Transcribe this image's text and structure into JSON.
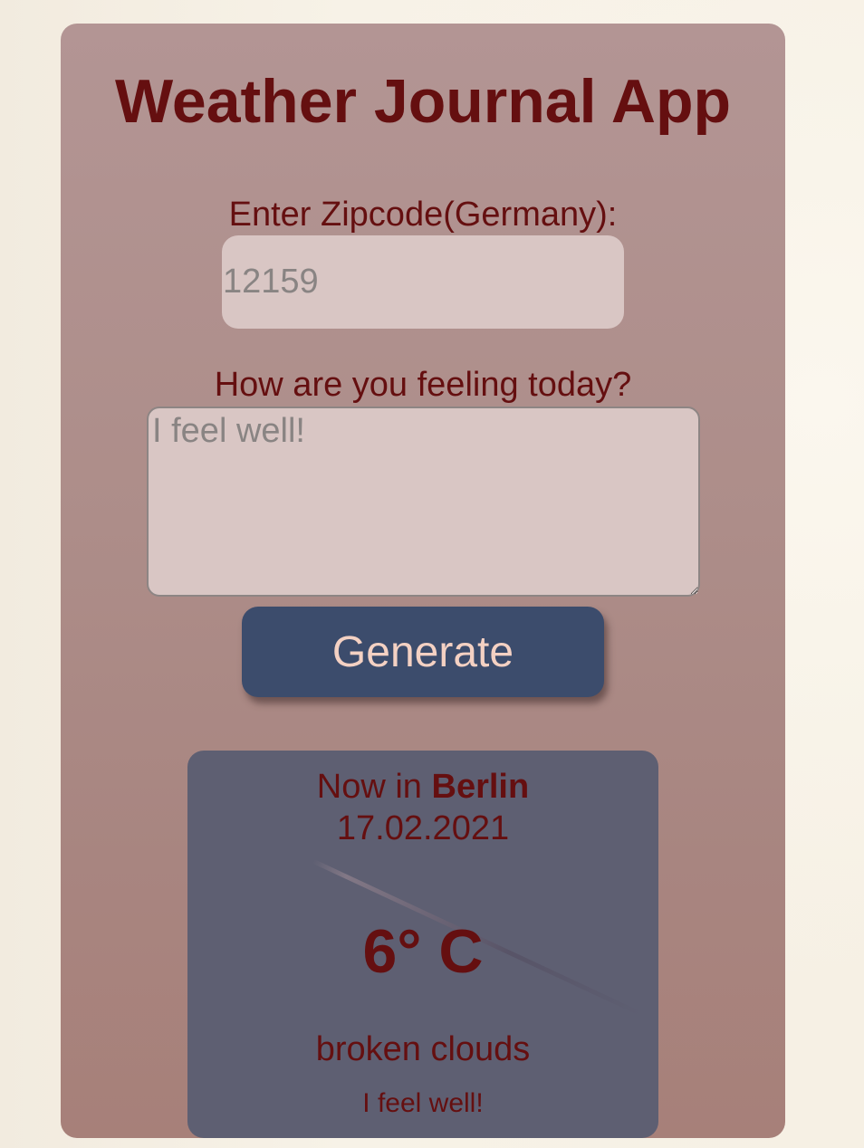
{
  "app": {
    "title": "Weather Journal App"
  },
  "form": {
    "zip_label": "Enter Zipcode(Germany):",
    "zip_placeholder": "12159",
    "feelings_label": "How are you feeling today?",
    "feelings_placeholder": "I feel well!",
    "generate_label": "Generate"
  },
  "entry": {
    "now_prefix": "Now in ",
    "city": "Berlin",
    "date": "17.02.2021",
    "temperature": "6° C",
    "description": "broken clouds",
    "content": "I feel well!"
  },
  "colors": {
    "title_text": "#650f10",
    "card_background": "#b39594",
    "input_background": "#d9c6c4",
    "button_background": "#3c4c6c",
    "button_text": "#f4d1c3",
    "result_background": "#5e5f72"
  }
}
